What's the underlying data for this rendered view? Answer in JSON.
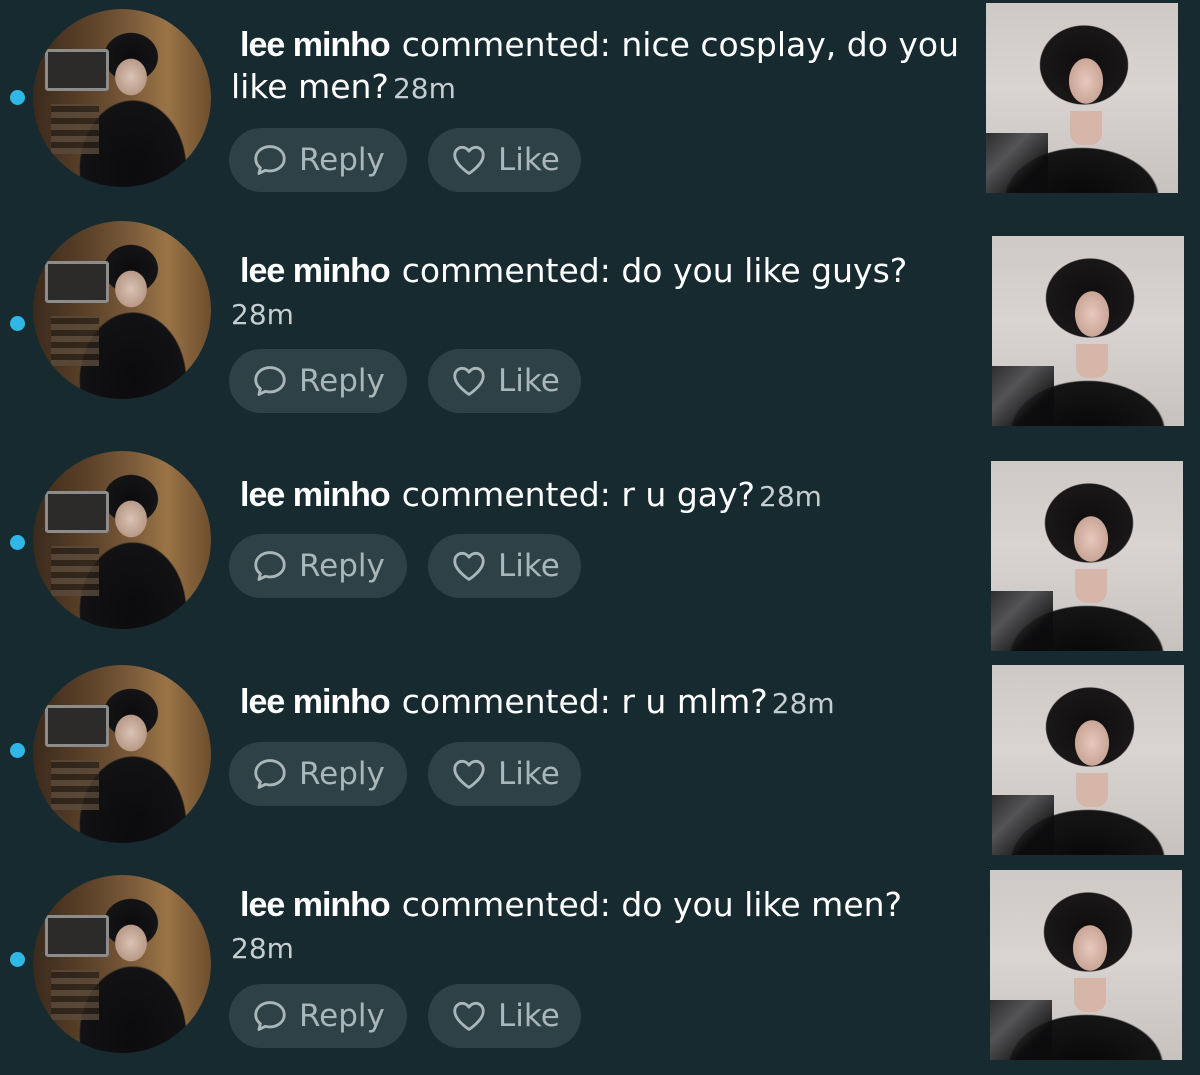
{
  "notifications": [
    {
      "username": "lee minho",
      "action": "commented:",
      "comment": "nice cosplay, do you like men?",
      "time": "28m",
      "reply_label": "Reply",
      "like_label": "Like"
    },
    {
      "username": "lee minho",
      "action": "commented:",
      "comment": "do you like guys?",
      "time": "28m",
      "reply_label": "Reply",
      "like_label": "Like"
    },
    {
      "username": "lee minho",
      "action": "commented:",
      "comment": "r u gay?",
      "time": "28m",
      "reply_label": "Reply",
      "like_label": "Like"
    },
    {
      "username": "lee minho",
      "action": "commented:",
      "comment": "r u mlm?",
      "time": "28m",
      "reply_label": "Reply",
      "like_label": "Like"
    },
    {
      "username": "lee minho",
      "action": "commented:",
      "comment": "do you like men?",
      "time": "28m",
      "reply_label": "Reply",
      "like_label": "Like"
    }
  ],
  "icons": {
    "reply": "speech-bubble-icon",
    "like": "heart-icon"
  },
  "colors": {
    "background": "#172a2f",
    "unread_dot": "#2fb8e6",
    "button_background": "#2d4147",
    "button_text": "#a9b6ba"
  }
}
